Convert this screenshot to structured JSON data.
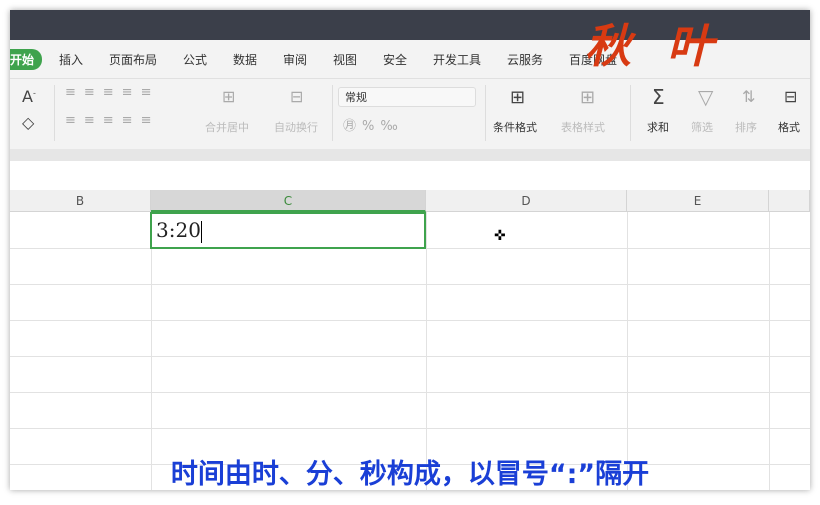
{
  "tabs": [
    "开始",
    "插入",
    "页面布局",
    "公式",
    "数据",
    "审阅",
    "视图",
    "安全",
    "开发工具",
    "云服务",
    "百度网盘"
  ],
  "ribbon": {
    "merge": "合并居中",
    "wrap": "自动换行",
    "number_format": "常规",
    "cond_format": "条件格式",
    "table_style": "表格样式",
    "sum": "求和",
    "filter": "筛选",
    "sort": "排序",
    "format": "格式"
  },
  "columns": [
    "B",
    "C",
    "D",
    "E"
  ],
  "cell_value": "3:20",
  "caption": "时间由时、分、秒构成，以冒号“:”隔开",
  "logo_text": "秋叶"
}
